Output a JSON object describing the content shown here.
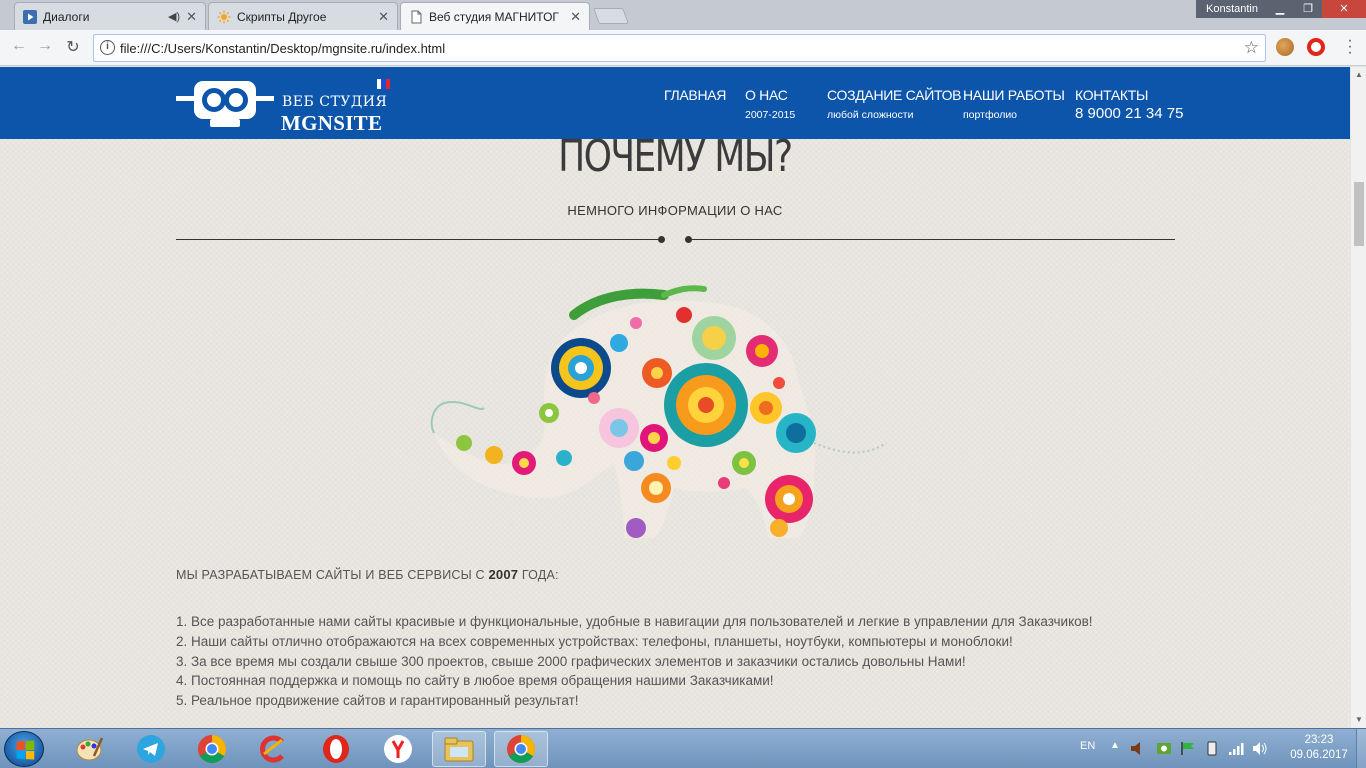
{
  "browser": {
    "tabs": [
      {
        "title": "Диалоги",
        "favicon": "play-icon",
        "active": false
      },
      {
        "title": "Скрипты Другое",
        "favicon": "sun-icon",
        "active": false
      },
      {
        "title": "Веб студия МАГНИТОГ",
        "favicon": "page-icon",
        "active": true
      }
    ],
    "profile_name": "Konstantin",
    "url": "file:///C:/Users/Konstantin/Desktop/mgnsite.ru/index.html"
  },
  "site": {
    "logo": {
      "line1": "ВЕБ СТУДИЯ",
      "line2": "MGNSITE"
    },
    "nav": [
      {
        "label": "ГЛАВНАЯ",
        "sub": ""
      },
      {
        "label": "О НАС",
        "sub": "2007-2015"
      },
      {
        "label": "СОЗДАНИЕ САЙТОВ",
        "sub": "любой сложности"
      },
      {
        "label": "НАШИ РАБОТЫ",
        "sub": "портфолио"
      },
      {
        "label": "КОНТАКТЫ",
        "sub": "8 9000 21 34 75"
      }
    ],
    "heading": "ПОЧЕМУ МЫ?",
    "subheading": "НЕМНОГО ИНФОРМАЦИИ О НАС",
    "intro_prefix": "МЫ РАЗРАБАТЫВАЕМ САЙТЫ И ВЕБ СЕРВИСЫ С ",
    "intro_year": "2007",
    "intro_suffix": " ГОДА:",
    "points": [
      "1. Все разработанные нами сайты красивые и функциональные, удобные в навигации для пользователей и легкие в управлении для Заказчиков!",
      "2. Наши сайты отлично отображаются на всех современных устройствах: телефоны, планшеты, ноутбуки, компьютеры и моноблоки!",
      "3. За все время мы создали свыше 300 проектов, свыше 2000 графических элементов и заказчики остались довольны Нами!",
      "4. Постоянная поддержка и помощь по сайту в любое время обращения нашими Заказчиками!",
      "5. Реальное продвижение сайтов и гарантированный результат!"
    ]
  },
  "taskbar": {
    "language": "EN",
    "time": "23:23",
    "date": "09.06.2017"
  },
  "colors": {
    "header_blue": "#0d55ab",
    "page_bg": "#ece8e2",
    "text_dark": "#3b3b3b"
  }
}
